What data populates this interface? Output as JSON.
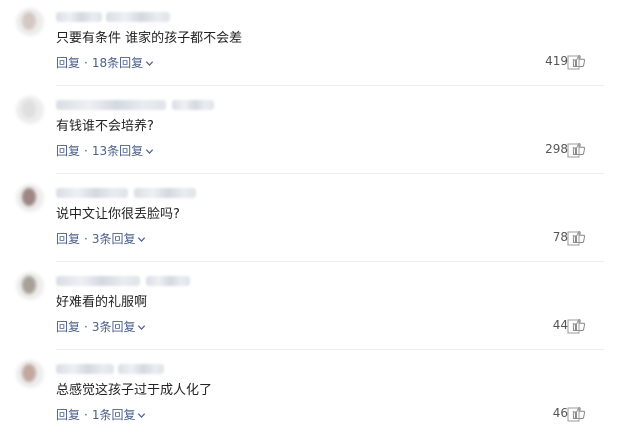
{
  "comments": [
    {
      "text": "只要有条件 谁家的孩子都不会差",
      "reply_label": "回复",
      "separator": "·",
      "replies_label": "18条回复",
      "likes": "419",
      "avatar_color": "#c9b8b0"
    },
    {
      "text": "有钱谁不会培养?",
      "reply_label": "回复",
      "separator": "·",
      "replies_label": "13条回复",
      "likes": "298",
      "avatar_color": "#d9d9d9"
    },
    {
      "text": "说中文让你很丢脸吗?",
      "reply_label": "回复",
      "separator": "·",
      "replies_label": "3条回复",
      "likes": "78",
      "avatar_color": "#7a5a55"
    },
    {
      "text": "好难看的礼服啊",
      "reply_label": "回复",
      "separator": "·",
      "replies_label": "3条回复",
      "likes": "44",
      "avatar_color": "#8a8070"
    },
    {
      "text": "总感觉这孩子过于成人化了",
      "reply_label": "回复",
      "separator": "·",
      "replies_label": "1条回复",
      "likes": "46",
      "avatar_color": "#b08a80"
    }
  ],
  "colors": {
    "link": "#4a5f8c",
    "text": "#222222",
    "meta": "#555555",
    "divider": "#ececec"
  },
  "icons": {
    "replies_toggle": "chevron-down-icon",
    "like": "thumbs-up-icon",
    "report": "report-icon"
  }
}
